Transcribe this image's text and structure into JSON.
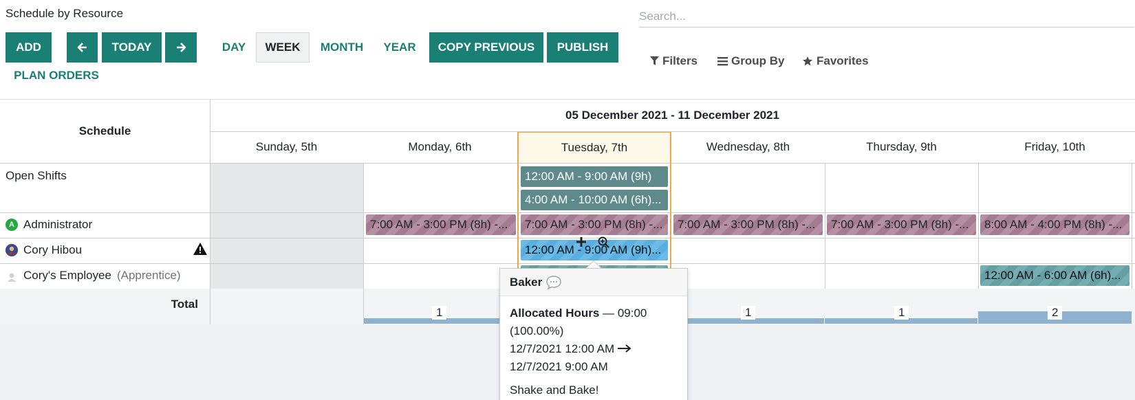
{
  "header": {
    "title": "Schedule by Resource",
    "buttons": {
      "add": "ADD",
      "today": "TODAY",
      "day": "DAY",
      "week": "WEEK",
      "month": "MONTH",
      "year": "YEAR",
      "copy_previous": "COPY PREVIOUS",
      "publish": "PUBLISH",
      "plan_orders": "PLAN ORDERS"
    },
    "search_placeholder": "Search...",
    "filters": "Filters",
    "group_by": "Group By",
    "favorites": "Favorites"
  },
  "gantt": {
    "schedule_header": "Schedule",
    "range": "05 December 2021 - 11 December 2021",
    "days": [
      "Sunday, 5th",
      "Monday, 6th",
      "Tuesday, 7th",
      "Wednesday, 8th",
      "Thursday, 9th",
      "Friday, 10th"
    ],
    "rows": {
      "open_shifts": "Open Shifts",
      "administrator": "Administrator",
      "administrator_initial": "A",
      "cory": "Cory Hibou",
      "employee": "Cory's Employee",
      "employee_role": "(Apprentice)",
      "total": "Total"
    },
    "pills": {
      "open1": "12:00 AM - 9:00 AM (9h)",
      "open2": "4:00 AM - 10:00 AM (6h)...",
      "admin_mon": "7:00 AM - 3:00 PM (8h) -...",
      "admin_tue": "7:00 AM - 3:00 PM (8h) -...",
      "admin_wed": "7:00 AM - 3:00 PM (8h) -...",
      "admin_thu": "7:00 AM - 3:00 PM (8h) -...",
      "admin_fri": "8:00 AM - 4:00 PM (8h) -...",
      "cory_tue": "12:00 AM - 9:00 AM (9h)...",
      "emp_fri": "12:00 AM - 6:00 AM (6h)..."
    },
    "totals": {
      "mon": "1",
      "wed": "1",
      "thu": "1",
      "fri": "2"
    }
  },
  "popover": {
    "title": "Baker",
    "allocated_label": "Allocated Hours",
    "allocated_value": "— 09:00",
    "allocated_pct": "(100.00%)",
    "start": "12/7/2021 12:00 AM",
    "end": "12/7/2021 9:00 AM",
    "note": "Shake and Bake!"
  },
  "colors": {
    "primary": "#1a7f74",
    "today_border": "#f0a64b"
  }
}
